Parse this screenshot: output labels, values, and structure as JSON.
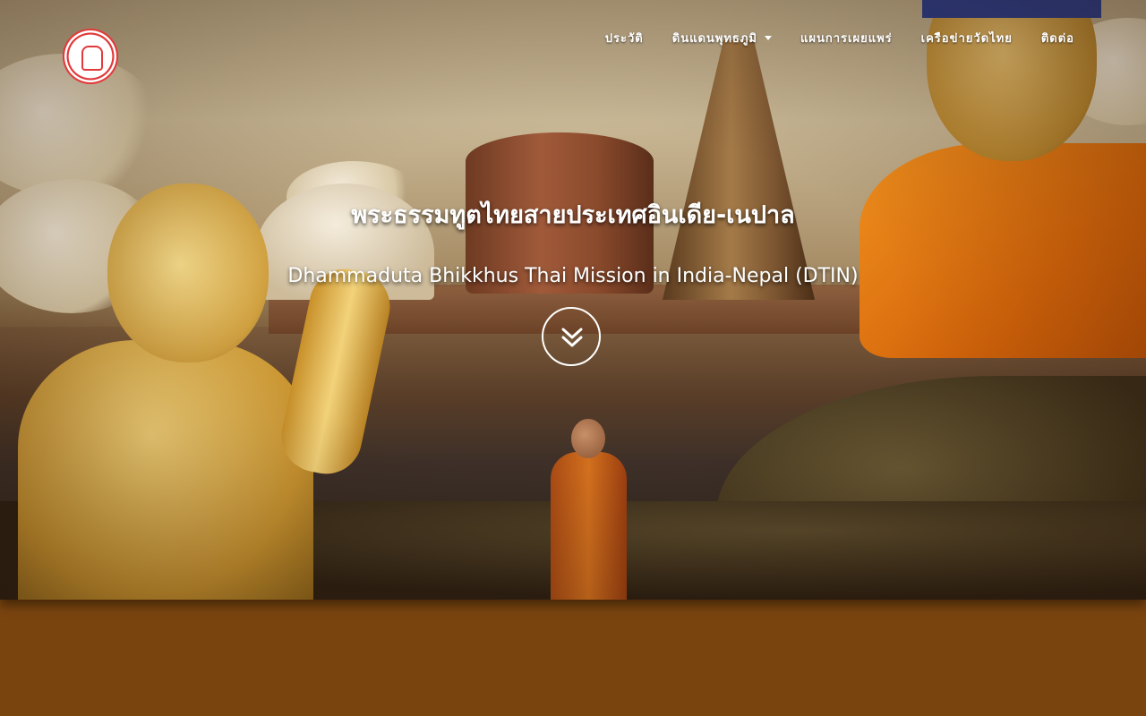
{
  "header": {
    "logo_icon": "temple-seal-logo-icon",
    "nav": [
      {
        "label": "ประวัติ",
        "has_dropdown": false
      },
      {
        "label": "ดินแดนพุทธภูมิ",
        "has_dropdown": true
      },
      {
        "label": "แผนการเผยแพร่",
        "has_dropdown": false
      },
      {
        "label": "เครือข่ายวัดไทย",
        "has_dropdown": false
      },
      {
        "label": "ติดต่อ",
        "has_dropdown": false
      }
    ]
  },
  "hero": {
    "title_th": "พระธรรมทูตไทยสายประเทศอินเดีย-เนปาล",
    "title_en": "Dhammaduta Bhikkhus Thai Mission in India-Nepal (DTIN)",
    "scroll_icon": "double-chevron-down-icon"
  },
  "colors": {
    "page_background": "#7a440f",
    "nav_text": "#ffffff",
    "logo_red": "#e23a3a"
  }
}
